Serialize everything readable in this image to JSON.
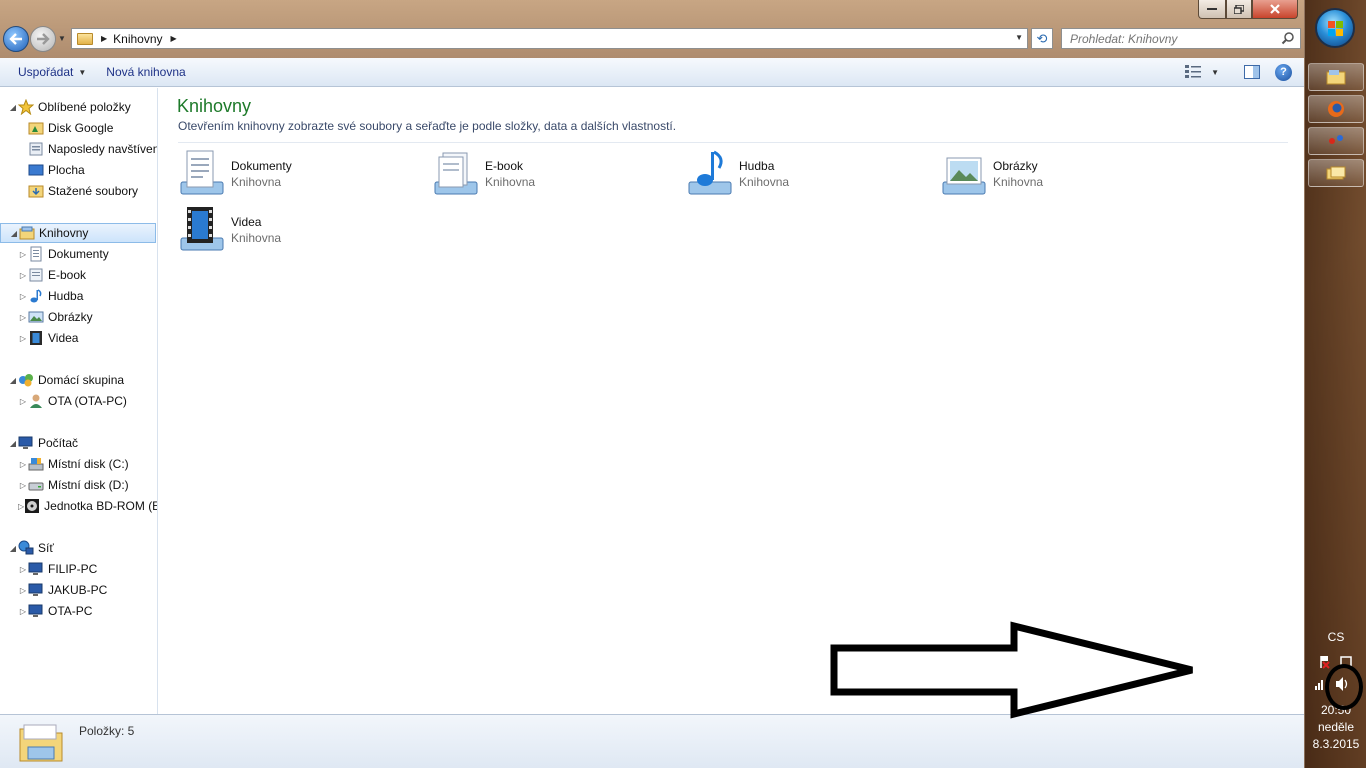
{
  "address": {
    "crumb": "Knihovny"
  },
  "search": {
    "placeholder": "Prohledat: Knihovny"
  },
  "toolbar": {
    "organize_label": "Uspořádat",
    "new_library_label": "Nová knihovna"
  },
  "navpane": {
    "favorites": {
      "label": "Oblíbené položky",
      "items": [
        "Disk Google",
        "Naposledy navštívené",
        "Plocha",
        "Stažené soubory"
      ]
    },
    "libraries": {
      "label": "Knihovny",
      "items": [
        "Dokumenty",
        "E-book",
        "Hudba",
        "Obrázky",
        "Videa"
      ]
    },
    "homegroup": {
      "label": "Domácí skupina",
      "items": [
        "OTA (OTA-PC)"
      ]
    },
    "computer": {
      "label": "Počítač",
      "items": [
        "Místní disk (C:)",
        "Místní disk (D:)",
        "Jednotka BD-ROM (E:)"
      ]
    },
    "network": {
      "label": "Síť",
      "items": [
        "FILIP-PC",
        "JAKUB-PC",
        "OTA-PC"
      ]
    }
  },
  "content": {
    "title": "Knihovny",
    "description": "Otevřením knihovny zobrazte své soubory a seřaďte je podle složky, data a dalších vlastností.",
    "libraries": [
      {
        "name": "Dokumenty",
        "type": "Knihovna",
        "icon": "documents-library-icon"
      },
      {
        "name": "E-book",
        "type": "Knihovna",
        "icon": "ebook-library-icon"
      },
      {
        "name": "Hudba",
        "type": "Knihovna",
        "icon": "music-library-icon"
      },
      {
        "name": "Obrázky",
        "type": "Knihovna",
        "icon": "pictures-library-icon"
      },
      {
        "name": "Videa",
        "type": "Knihovna",
        "icon": "videos-library-icon"
      }
    ]
  },
  "status": {
    "items_text": "Položky: 5"
  },
  "tray": {
    "language": "CS",
    "time": "20:50",
    "day": "neděle",
    "date": "8.3.2015"
  },
  "colors": {
    "title_green": "#1e7a2a",
    "toolbar_text": "#1e3287",
    "selection": "#cde4fb"
  }
}
